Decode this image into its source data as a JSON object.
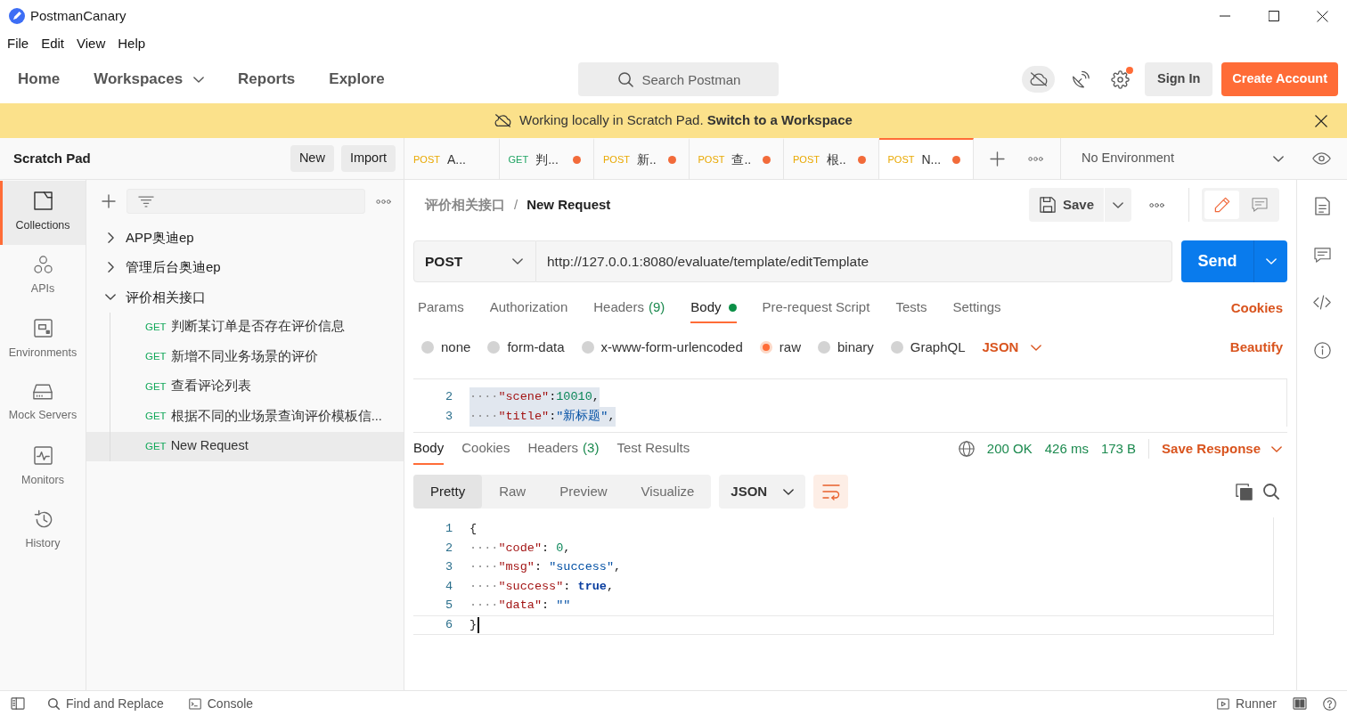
{
  "window": {
    "title": "PostmanCanary"
  },
  "menu": [
    "File",
    "Edit",
    "View",
    "Help"
  ],
  "header": {
    "nav": [
      {
        "label": "Home",
        "dropdown": false
      },
      {
        "label": "Workspaces",
        "dropdown": true
      },
      {
        "label": "Reports",
        "dropdown": false
      },
      {
        "label": "Explore",
        "dropdown": false
      }
    ],
    "search": {
      "placeholder": "Search Postman"
    },
    "settings_notification": true,
    "sign_in": "Sign In",
    "create_account": "Create Account"
  },
  "banner": {
    "text": "Working locally in Scratch Pad. **Switch to a Workspace**"
  },
  "sidebar": {
    "title": "Scratch Pad",
    "buttons": [
      "New",
      "Import"
    ],
    "rail": [
      {
        "kind": "collections",
        "label": "Collections",
        "selected": true
      },
      {
        "kind": "apis",
        "label": "APIs",
        "selected": false
      },
      {
        "kind": "environments",
        "label": "Environments",
        "selected": false
      },
      {
        "kind": "mock_servers",
        "label": "Mock Servers",
        "selected": false
      },
      {
        "kind": "monitors",
        "label": "Monitors",
        "selected": false
      },
      {
        "kind": "history",
        "label": "History",
        "selected": false
      }
    ],
    "tree": [
      {
        "kind": "collection",
        "name": "APP奥迪ep",
        "expanded": false,
        "selected": false
      },
      {
        "kind": "collection",
        "name": "管理后台奥迪ep",
        "expanded": false,
        "selected": false
      },
      {
        "kind": "collection",
        "name": "评价相关接口",
        "expanded": true,
        "selected": false,
        "children": [
          {
            "kind": "request",
            "method": "GET",
            "name": "判断某订单是否存在评价信息",
            "selected": false
          },
          {
            "kind": "request",
            "method": "GET",
            "name": "新增不同业务场景的评价",
            "selected": false
          },
          {
            "kind": "request",
            "method": "GET",
            "name": "查看评论列表",
            "selected": false
          },
          {
            "kind": "request",
            "method": "GET",
            "name": "根据不同的业场景查询评价模板信...",
            "selected": false
          },
          {
            "kind": "request",
            "method": "GET",
            "name": "New Request",
            "selected": true
          }
        ]
      }
    ]
  },
  "tabs": [
    {
      "method": "POST",
      "color": "#e9a800",
      "title": "A...",
      "unsaved": false,
      "selected": false
    },
    {
      "method": "GET",
      "color": "#1fa463",
      "title": "判...",
      "unsaved": true,
      "selected": false
    },
    {
      "method": "POST",
      "color": "#e9a800",
      "title": "新..",
      "unsaved": true,
      "selected": false
    },
    {
      "method": "POST",
      "color": "#e9a800",
      "title": "查..",
      "unsaved": true,
      "selected": false
    },
    {
      "method": "POST",
      "color": "#e9a800",
      "title": "根..",
      "unsaved": true,
      "selected": false
    },
    {
      "method": "POST",
      "color": "#e9a800",
      "title": "N...",
      "unsaved": true,
      "selected": true
    }
  ],
  "environment": {
    "value": "No Environment"
  },
  "request": {
    "breadcrumb": {
      "parent": "评价相关接口",
      "separator": "/",
      "current": "New Request"
    },
    "save": "Save",
    "mode": [
      {
        "kind": "edit",
        "selected": true
      },
      {
        "kind": "comments",
        "selected": false
      }
    ],
    "method": "POST",
    "url": "http://127.0.0.1:8080/evaluate/template/editTemplate",
    "send": "Send",
    "tabs": [
      {
        "label": "Params",
        "has_content": false,
        "selected": false
      },
      {
        "label": "Authorization",
        "has_content": false,
        "selected": false
      },
      {
        "label": "Headers",
        "count": "(9)",
        "has_content": false,
        "selected": false
      },
      {
        "label": "Body",
        "has_content": true,
        "selected": true
      },
      {
        "label": "Pre-request Script",
        "has_content": false,
        "selected": false
      },
      {
        "label": "Tests",
        "has_content": false,
        "selected": false
      },
      {
        "label": "Settings",
        "has_content": false,
        "selected": false
      }
    ],
    "cookies": "Cookies",
    "body_types": [
      {
        "label": "none",
        "selected": false
      },
      {
        "label": "form-data",
        "selected": false
      },
      {
        "label": "x-www-form-urlencoded",
        "selected": false
      },
      {
        "label": "raw",
        "selected": true
      },
      {
        "label": "binary",
        "selected": false
      },
      {
        "label": "GraphQL",
        "selected": false
      }
    ],
    "format": "JSON",
    "beautify": "Beautify",
    "body_lines": [
      {
        "number": "2",
        "highlighted": true,
        "tokens": [
          {
            "kind": "space",
            "text": "····"
          },
          {
            "kind": "key",
            "text": "\"scene\""
          },
          {
            "kind": "punct",
            "text": ":"
          },
          {
            "kind": "number",
            "text": "10010"
          },
          {
            "kind": "punct",
            "text": ","
          }
        ]
      },
      {
        "number": "3",
        "highlighted": true,
        "tokens": [
          {
            "kind": "space",
            "text": "····"
          },
          {
            "kind": "key",
            "text": "\"title\""
          },
          {
            "kind": "punct",
            "text": ":"
          },
          {
            "kind": "string",
            "text": "\"新标题\""
          },
          {
            "kind": "punct",
            "text": ","
          }
        ]
      }
    ]
  },
  "response": {
    "tabs": [
      {
        "label": "Body",
        "selected": true
      },
      {
        "label": "Cookies",
        "selected": false
      },
      {
        "label": "Headers",
        "count": "(3)",
        "selected": false
      },
      {
        "label": "Test Results",
        "selected": false
      }
    ],
    "status": "200 OK",
    "time": "426 ms",
    "size": "173 B",
    "save": "Save Response",
    "views": [
      {
        "label": "Pretty",
        "selected": true
      },
      {
        "label": "Raw",
        "selected": false
      },
      {
        "label": "Preview",
        "selected": false
      },
      {
        "label": "Visualize",
        "selected": false
      }
    ],
    "format": "JSON",
    "wrap_lines": true,
    "lines": [
      {
        "number": "1",
        "active": false,
        "tokens": [
          {
            "kind": "punct",
            "text": "{"
          }
        ]
      },
      {
        "number": "2",
        "active": false,
        "tokens": [
          {
            "kind": "space",
            "text": "····"
          },
          {
            "kind": "key",
            "text": "\"code\""
          },
          {
            "kind": "punct",
            "text": ": "
          },
          {
            "kind": "number",
            "text": "0"
          },
          {
            "kind": "punct",
            "text": ","
          }
        ]
      },
      {
        "number": "3",
        "active": false,
        "tokens": [
          {
            "kind": "space",
            "text": "····"
          },
          {
            "kind": "key",
            "text": "\"msg\""
          },
          {
            "kind": "punct",
            "text": ": "
          },
          {
            "kind": "string",
            "text": "\"success\""
          },
          {
            "kind": "punct",
            "text": ","
          }
        ]
      },
      {
        "number": "4",
        "active": false,
        "tokens": [
          {
            "kind": "space",
            "text": "····"
          },
          {
            "kind": "key",
            "text": "\"success\""
          },
          {
            "kind": "punct",
            "text": ": "
          },
          {
            "kind": "keyword",
            "text": "true"
          },
          {
            "kind": "punct",
            "text": ","
          }
        ]
      },
      {
        "number": "5",
        "active": false,
        "tokens": [
          {
            "kind": "space",
            "text": "····"
          },
          {
            "kind": "key",
            "text": "\"data\""
          },
          {
            "kind": "punct",
            "text": ": "
          },
          {
            "kind": "string",
            "text": "\"\""
          }
        ]
      },
      {
        "number": "6",
        "active": true,
        "tokens": [
          {
            "kind": "punct",
            "text": "}"
          }
        ]
      }
    ]
  },
  "status_bar": {
    "find": "Find and Replace",
    "console": "Console",
    "runner": "Runner"
  }
}
